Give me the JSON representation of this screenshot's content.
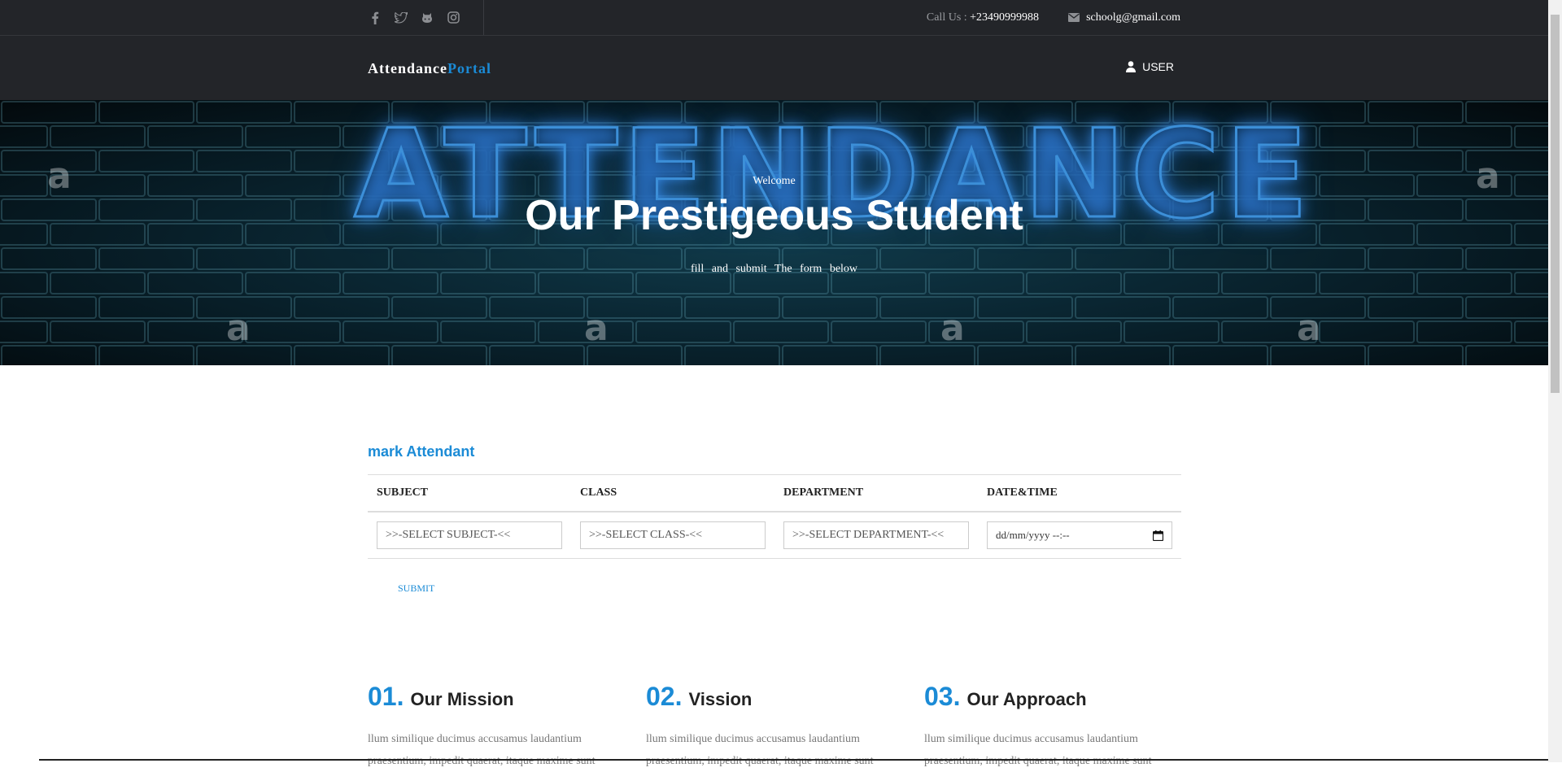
{
  "topbar": {
    "social": [
      {
        "icon": "facebook-icon"
      },
      {
        "icon": "twitter-icon"
      },
      {
        "icon": "github-icon"
      },
      {
        "icon": "instagram-icon"
      }
    ],
    "call_label": "Call Us :",
    "phone": "+23490999988",
    "email": "schoolg@gmail.com"
  },
  "navbar": {
    "brand_main": "Attendance",
    "brand_accent": "Portal",
    "user_label": "USER"
  },
  "hero": {
    "neon_text": "ATTENDANCE",
    "welcome": "Welcome",
    "title": "Our Prestigeous Student",
    "subtitle": "fill and submit The form below"
  },
  "form": {
    "title": "mark Attendant",
    "columns": [
      "SUBJECT",
      "CLASS",
      "DEPARTMENT",
      "DATE&TIME"
    ],
    "subject_value": ">>-SELECT SUBJECT-<<",
    "class_value": ">>-SELECT CLASS-<<",
    "department_value": ">>-SELECT DEPARTMENT-<<",
    "datetime_placeholder": "dd/mm/yyyy --:--",
    "submit_label": "SUBMIT"
  },
  "features": [
    {
      "num": "01.",
      "name": "Our Mission",
      "text": "llum similique ducimus accusamus laudantium praesentium, impedit quaerat, itaque maxime sunt"
    },
    {
      "num": "02.",
      "name": "Vission",
      "text": "llum similique ducimus accusamus laudantium praesentium, impedit quaerat, itaque maxime sunt"
    },
    {
      "num": "03.",
      "name": "Our Approach",
      "text": "llum similique ducimus accusamus laudantium praesentium, impedit quaerat, itaque maxime sunt"
    }
  ],
  "colors": {
    "accent": "#1b8bd6",
    "dark": "#232529"
  }
}
